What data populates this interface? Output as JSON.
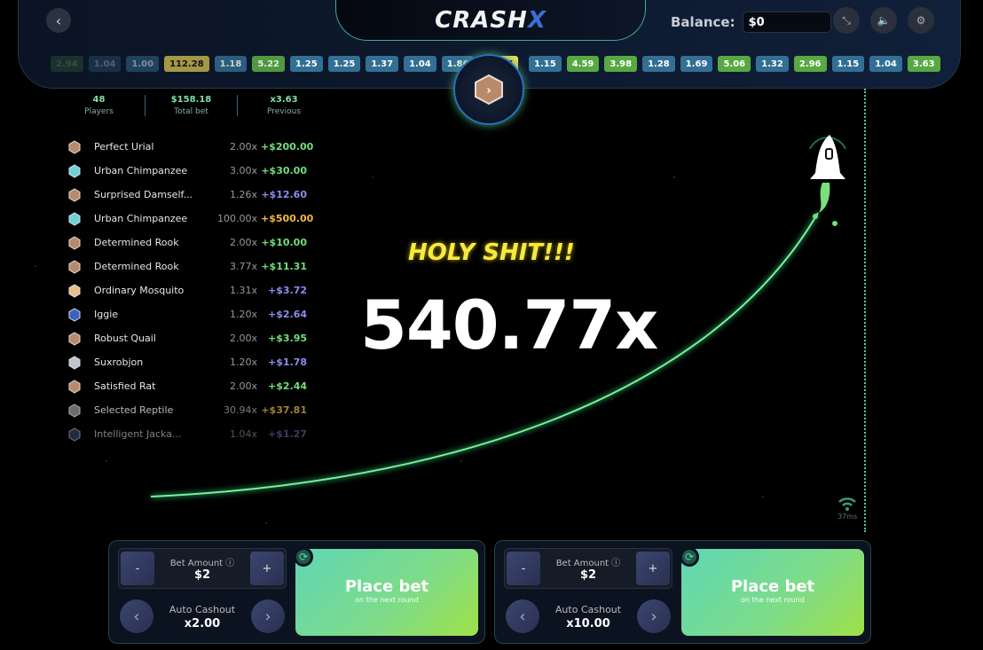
{
  "app": {
    "logo": "CRASH",
    "logo_x": "X"
  },
  "balance": {
    "label": "Balance:",
    "value": "$0"
  },
  "icons": {
    "back": "chevron-left-icon",
    "fullscreen": "expand-icon",
    "sound": "speaker-icon",
    "settings": "gear-icon"
  },
  "history_left": [
    {
      "v": "2.94",
      "t": "green",
      "dim": 0.2
    },
    {
      "v": "1.04",
      "t": "blue",
      "dim": 0.3
    },
    {
      "v": "1.00",
      "t": "blue",
      "dim": 0.5
    },
    {
      "v": "112.28",
      "t": "gold",
      "dim": 0.65
    },
    {
      "v": "1.18",
      "t": "blue",
      "dim": 0.8
    },
    {
      "v": "5.22",
      "t": "green",
      "dim": 0.9
    },
    {
      "v": "1.25",
      "t": "blue",
      "dim": 1
    },
    {
      "v": "1.25",
      "t": "blue",
      "dim": 1
    },
    {
      "v": "1.37",
      "t": "blue",
      "dim": 1
    },
    {
      "v": "1.04",
      "t": "blue",
      "dim": 1
    },
    {
      "v": "1.86",
      "t": "blue",
      "dim": 1
    },
    {
      "v": "16.37",
      "t": "gold",
      "dim": 1
    }
  ],
  "history_right": [
    {
      "v": "1.15",
      "t": "blue"
    },
    {
      "v": "4.59",
      "t": "green"
    },
    {
      "v": "3.98",
      "t": "green"
    },
    {
      "v": "1.28",
      "t": "blue"
    },
    {
      "v": "1.69",
      "t": "blue"
    },
    {
      "v": "5.06",
      "t": "green"
    },
    {
      "v": "1.32",
      "t": "blue"
    },
    {
      "v": "2.96",
      "t": "green"
    },
    {
      "v": "1.15",
      "t": "blue"
    },
    {
      "v": "1.04",
      "t": "blue"
    },
    {
      "v": "3.63",
      "t": "green"
    }
  ],
  "stats": [
    {
      "value": "48",
      "label": "Players"
    },
    {
      "value": "$158.18",
      "label": "Total bet"
    },
    {
      "value": "x3.63",
      "label": "Previous"
    }
  ],
  "players": [
    {
      "name": "Perfect Urial",
      "mult": "2.00x",
      "win": "+$200.00",
      "color": "#6ee07a",
      "avatar": "#b98a6a"
    },
    {
      "name": "Urban Chimpanzee",
      "mult": "3.00x",
      "win": "+$30.00",
      "color": "#6ee07a",
      "avatar": "#6fd0d6"
    },
    {
      "name": "Surprised Damself...",
      "mult": "1.26x",
      "win": "+$12.60",
      "color": "#8c8cf0",
      "avatar": "#b98a6a"
    },
    {
      "name": "Urban Chimpanzee",
      "mult": "100.00x",
      "win": "+$500.00",
      "color": "#f2b938",
      "avatar": "#6fd0d6"
    },
    {
      "name": "Determined Rook",
      "mult": "2.00x",
      "win": "+$10.00",
      "color": "#6ee07a",
      "avatar": "#b98a6a"
    },
    {
      "name": "Determined Rook",
      "mult": "3.77x",
      "win": "+$11.31",
      "color": "#6ee07a",
      "avatar": "#b98a6a"
    },
    {
      "name": "Ordinary Mosquito",
      "mult": "1.31x",
      "win": "+$3.72",
      "color": "#8c8cf0",
      "avatar": "#e8c088"
    },
    {
      "name": "Iggie",
      "mult": "1.20x",
      "win": "+$2.64",
      "color": "#8c8cf0",
      "avatar": "#3a60c0"
    },
    {
      "name": "Robust Quail",
      "mult": "2.00x",
      "win": "+$3.95",
      "color": "#6ee07a",
      "avatar": "#b98a6a"
    },
    {
      "name": "Suxrobjon",
      "mult": "1.20x",
      "win": "+$1.78",
      "color": "#8c8cf0",
      "avatar": "#c0c4d0"
    },
    {
      "name": "Satisfied Rat",
      "mult": "2.00x",
      "win": "+$2.44",
      "color": "#6ee07a",
      "avatar": "#b98a6a"
    },
    {
      "name": "Selected Reptile",
      "mult": "30.94x",
      "win": "+$37.81",
      "color": "#c8a040",
      "avatar": "#888",
      "dim": 0.8
    },
    {
      "name": "Intelligent Jacka...",
      "mult": "1.04x",
      "win": "+$1.27",
      "color": "#6870b8",
      "avatar": "#3a5070",
      "dim": 0.55
    }
  ],
  "game": {
    "exclaim": "HOLY SHIT!!!",
    "multiplier": "540.77x",
    "ping": "37ms"
  },
  "bet_panels": [
    {
      "minus": "-",
      "plus": "+",
      "bet_label": "Bet Amount",
      "bet_value": "$2",
      "cashout_label": "Auto Cashout",
      "cashout_value": "x2.00",
      "button": "Place bet",
      "button_sub": "on the next round"
    },
    {
      "minus": "-",
      "plus": "+",
      "bet_label": "Bet Amount",
      "bet_value": "$2",
      "cashout_label": "Auto Cashout",
      "cashout_value": "x10.00",
      "button": "Place bet",
      "button_sub": "on the next round"
    }
  ],
  "colors": {
    "accent": "#5fd6b6",
    "chip_blue": "#336f94",
    "chip_green": "#58a843",
    "chip_gold": "#f6dc55",
    "trail": "#4fe08a"
  }
}
